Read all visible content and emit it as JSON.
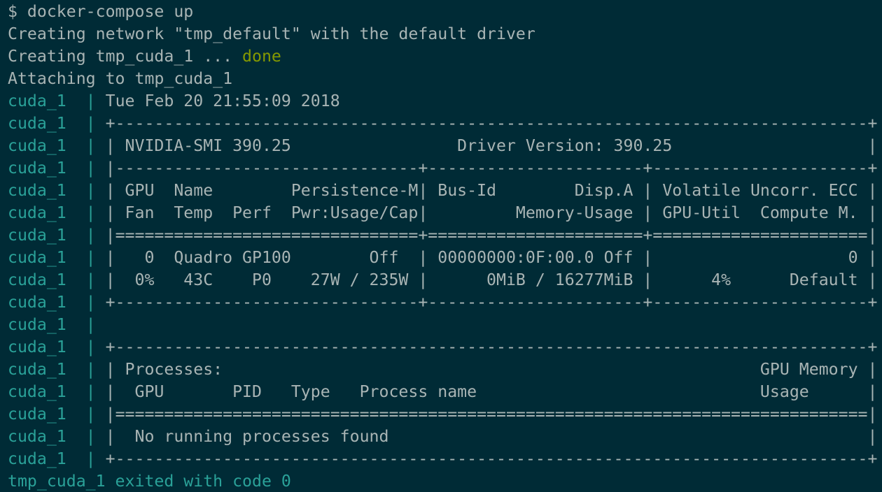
{
  "terminal": {
    "prompt": "$ ",
    "command": "docker-compose up",
    "status_lines": [
      "Creating network \"tmp_default\" with the default driver",
      "Creating tmp_cuda_1 ... ",
      "Attaching to tmp_cuda_1"
    ],
    "done_label": "done",
    "log_prefix": "cuda_1  | ",
    "log_lines": [
      "Tue Feb 20 21:55:09 2018",
      "+-----------------------------------------------------------------------------+",
      "| NVIDIA-SMI 390.25                 Driver Version: 390.25                    |",
      "|-------------------------------+----------------------+----------------------+",
      "| GPU  Name        Persistence-M| Bus-Id        Disp.A | Volatile Uncorr. ECC |",
      "| Fan  Temp  Perf  Pwr:Usage/Cap|         Memory-Usage | GPU-Util  Compute M. |",
      "|===============================+======================+======================|",
      "|   0  Quadro GP100        Off  | 00000000:0F:00.0 Off |                    0 |",
      "|  0%   43C    P0    27W / 235W |      0MiB / 16277MiB |      4%      Default |",
      "+-------------------------------+----------------------+----------------------+",
      "",
      "+-----------------------------------------------------------------------------+",
      "| Processes:                                                       GPU Memory |",
      "|  GPU       PID   Type   Process name                             Usage      |",
      "|=============================================================================|",
      "|  No running processes found                                                 |",
      "+-----------------------------------------------------------------------------+"
    ],
    "exit_line": "tmp_cuda_1 exited with code 0"
  },
  "colors": {
    "background": "#002b36",
    "foreground": "#a8b4b4",
    "container_prefix": "#2aa198",
    "done": "#859900"
  }
}
